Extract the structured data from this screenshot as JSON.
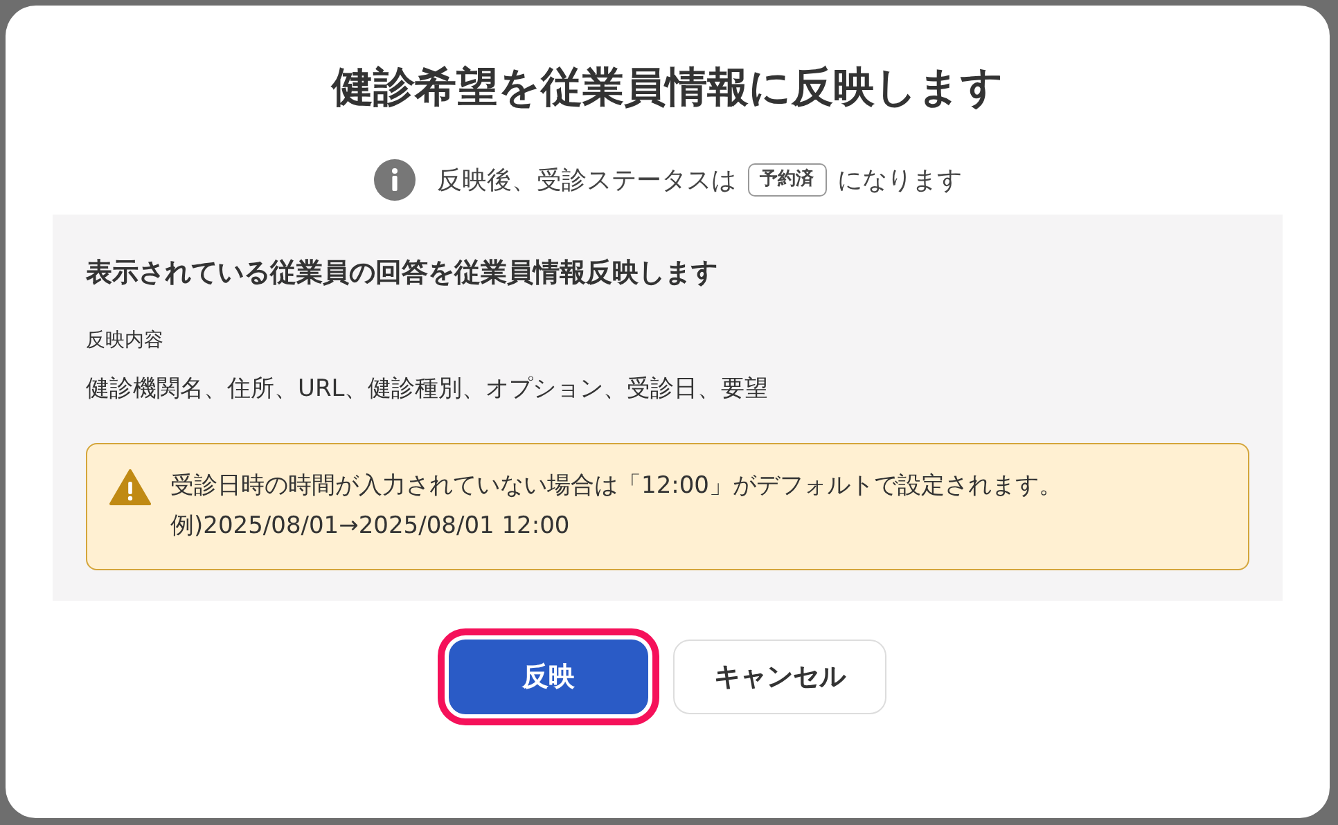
{
  "dialog": {
    "title": "健診希望を従業員情報に反映します",
    "notice": {
      "before": "反映後、受診ステータスは",
      "badge": "予約済",
      "after": "になります"
    },
    "panel": {
      "heading": "表示されている従業員の回答を従業員情報反映します",
      "label": "反映内容",
      "content": "健診機関名、住所、URL、健診種別、オプション、受診日、要望",
      "warning": "受診日時の時間が入力されていない場合は「12:00」がデフォルトで設定されます。例)2025/08/01→2025/08/01 12:00"
    },
    "buttons": [
      {
        "label": "反映",
        "kind": "primary",
        "highlighted": true
      },
      {
        "label": "キャンセル",
        "kind": "secondary",
        "highlighted": false
      }
    ]
  }
}
